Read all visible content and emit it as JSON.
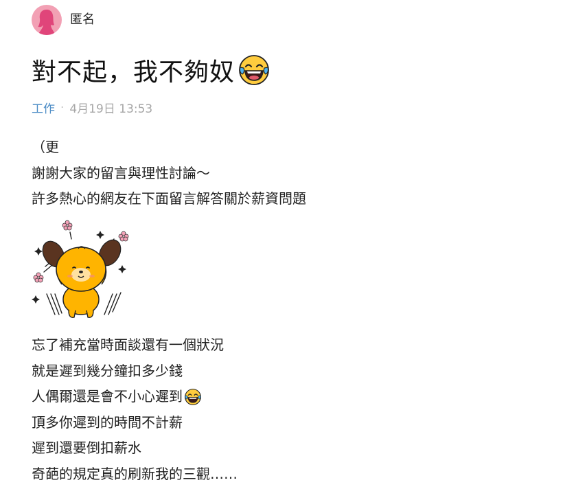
{
  "author": {
    "name": "匿名",
    "avatar_color": "#f2a0b4"
  },
  "post": {
    "title": "對不起，我不夠奴",
    "title_emoji": "laughing-with-tears-emoji",
    "category": "工作",
    "separator": "·",
    "timestamp": "4月19日 13:53",
    "paragraph1": [
      "（更",
      "謝謝大家的留言與理性討論～",
      "許多熱心的網友在下面留言解答關於薪資問題"
    ],
    "sticker": "cheering-dog-sticker",
    "paragraph2": [
      "忘了補充當時面談還有一個狀況",
      "就是遲到幾分鐘扣多少錢",
      "人偶爾還是會不小心遲到",
      "頂多你遲到的時間不計薪",
      "遲到還要倒扣薪水",
      "奇葩的規定真的刷新我的三觀……"
    ],
    "category_color": "#4e8dc6"
  }
}
